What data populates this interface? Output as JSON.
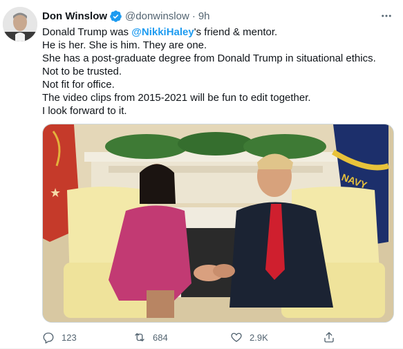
{
  "author": {
    "display_name": "Don Winslow",
    "handle": "@donwinslow",
    "separator": "·",
    "time": "9h",
    "verified": true
  },
  "tweet": {
    "line1_prefix": "Donald Trump was ",
    "mention": "@NikkiHaley",
    "line1_suffix": "'s friend & mentor.",
    "lines": [
      "He is her. She is him.  They are one.",
      "She has a post-graduate degree from Donald Trump in situational ethics.",
      "Not to be trusted.",
      "Not fit for office.",
      "The video clips from 2015-2021 will be fun to edit together.",
      "I look forward to it."
    ]
  },
  "media": {
    "flag_text": "NAVY"
  },
  "actions": {
    "reply_count": "123",
    "retweet_count": "684",
    "like_count": "2.9K"
  },
  "colors": {
    "link": "#1d9bf0",
    "verified": "#1d9bf0",
    "secondary_text": "#536471"
  },
  "icons": {
    "reply": "reply-icon",
    "retweet": "retweet-icon",
    "like": "heart-icon",
    "share": "share-icon",
    "more": "more-icon",
    "verified": "verified-badge-icon"
  }
}
